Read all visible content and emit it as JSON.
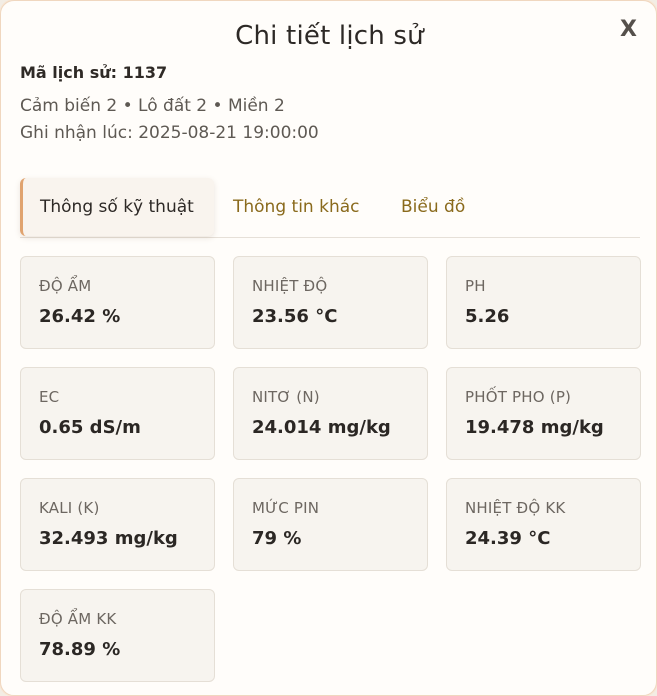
{
  "modal": {
    "title": "Chi tiết lịch sử",
    "close_label": "X",
    "history_id": "Mã lịch sử: 1137",
    "location": "Cảm biến 2 • Lô đất 2 • Miền 2",
    "recorded_at": "Ghi nhận lúc: 2025-08-21 19:00:00"
  },
  "tabs": [
    {
      "label": "Thông số kỹ thuật",
      "active": true
    },
    {
      "label": "Thông tin khác",
      "active": false
    },
    {
      "label": "Biểu đồ",
      "active": false
    }
  ],
  "metrics": [
    {
      "label": "ĐỘ ẨM",
      "value": "26.42 %"
    },
    {
      "label": "NHIỆT ĐỘ",
      "value": "23.56 °C"
    },
    {
      "label": "PH",
      "value": "5.26"
    },
    {
      "label": "EC",
      "value": "0.65 dS/m"
    },
    {
      "label": "NITƠ (N)",
      "value": "24.014 mg/kg"
    },
    {
      "label": "PHỐT PHO (P)",
      "value": "19.478 mg/kg"
    },
    {
      "label": "KALI (K)",
      "value": "32.493 mg/kg"
    },
    {
      "label": "MỨC PIN",
      "value": "79 %"
    },
    {
      "label": "NHIỆT ĐỘ KK",
      "value": "24.39 °C"
    },
    {
      "label": "ĐỘ ẨM KK",
      "value": "78.89 %"
    }
  ],
  "colors": {
    "accent": "#e0a36f",
    "tab_text": "#8a6a1c",
    "card_bg": "#f7f4ef"
  }
}
